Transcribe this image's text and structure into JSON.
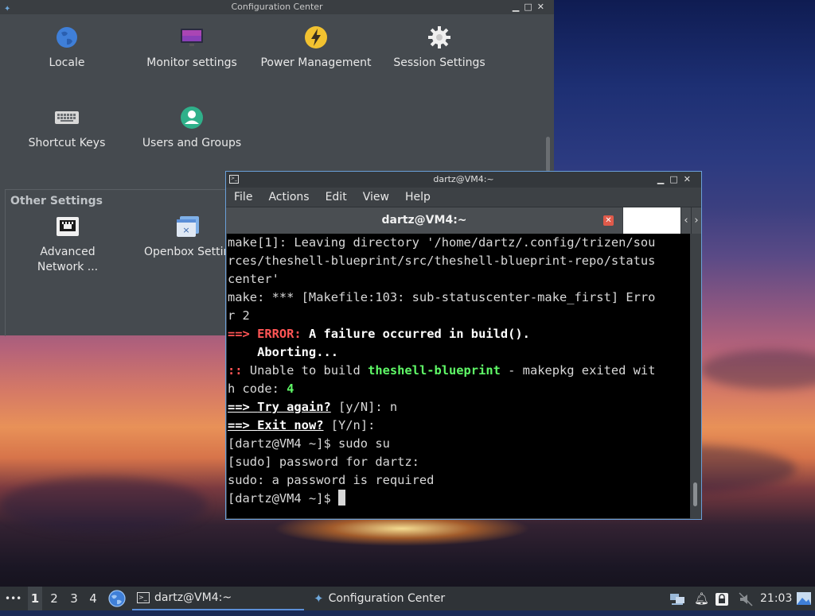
{
  "config_center": {
    "title": "Configuration Center",
    "items": [
      {
        "label": "Locale",
        "icon": "globe-icon"
      },
      {
        "label": "Monitor settings",
        "icon": "monitor-icon"
      },
      {
        "label": "Power Management",
        "icon": "power-icon"
      },
      {
        "label": "Session Settings",
        "icon": "gear-icon"
      },
      {
        "label": "Shortcut Keys",
        "icon": "keyboard-icon"
      },
      {
        "label": "Users and Groups",
        "icon": "user-icon"
      }
    ],
    "other_section_title": "Other Settings",
    "other_items": [
      {
        "label": "Advanced Network ...",
        "icon": "network-icon"
      },
      {
        "label": "Openbox Settin",
        "icon": "openbox-icon"
      }
    ]
  },
  "terminal": {
    "window_title": "dartz@VM4:~",
    "menu": [
      "File",
      "Actions",
      "Edit",
      "View",
      "Help"
    ],
    "tab_title": "dartz@VM4:~",
    "lines": {
      "l1": "make[1]: Leaving directory '/home/dartz/.config/trizen/sou",
      "l2": "rces/theshell-blueprint/src/theshell-blueprint-repo/status",
      "l3": "center'",
      "l4": "make: *** [Makefile:103: sub-statuscenter-make_first] Erro",
      "l5": "r 2",
      "err_arrow": "==> ",
      "err_label": "ERROR:",
      "err_msg": " A failure occurred in build().",
      "aborting": "    Aborting...",
      "unable_prefix": ":: ",
      "unable_text": "Unable to build ",
      "unable_pkg": "theshell-blueprint",
      "unable_rest": " - makepkg exited wit",
      "code_text": "h code: ",
      "code_val": "4",
      "try_arrow": "==> ",
      "try_q": "Try again?",
      "try_opts": " [y/N]: n",
      "exit_arrow": "==> ",
      "exit_q": "Exit now?",
      "exit_opts": " [Y/n]:",
      "sudo_cmd": "[dartz@VM4 ~]$ sudo su",
      "sudo_prompt": "[sudo] password for dartz:",
      "sudo_err": "sudo: a password is required",
      "prompt": "[dartz@VM4 ~]$ "
    }
  },
  "taskbar": {
    "menu_dots": "•••",
    "workspaces": [
      "1",
      "2",
      "3",
      "4"
    ],
    "active_workspace": "1",
    "tasks": [
      {
        "label": "dartz@VM4:~",
        "icon": "terminal-icon"
      },
      {
        "label": "Configuration Center",
        "icon": "config-icon"
      }
    ],
    "clock": "21:03"
  },
  "colors": {
    "accent": "#5b8fd8",
    "error": "#ff5555",
    "package": "#5ff967"
  }
}
